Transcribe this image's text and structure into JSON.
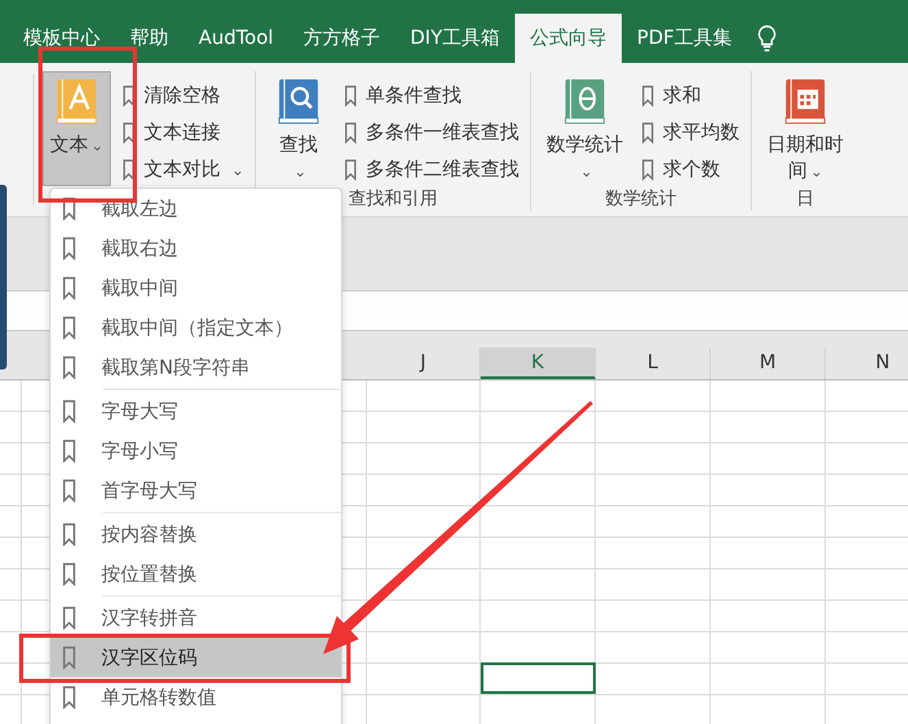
{
  "tabs": [
    {
      "label": "模板中心",
      "selected": false
    },
    {
      "label": "帮助",
      "selected": false
    },
    {
      "label": "AudTool",
      "selected": false
    },
    {
      "label": "方方格子",
      "selected": false
    },
    {
      "label": "DIY工具箱",
      "selected": false
    },
    {
      "label": "公式向导",
      "selected": true
    },
    {
      "label": "PDF工具集",
      "selected": false
    }
  ],
  "ribbon": {
    "groups": [
      {
        "large": {
          "label": "文本",
          "kind": "text",
          "selected": true,
          "caret": "⌄"
        },
        "small": [
          {
            "label": "清除空格"
          },
          {
            "label": "文本连接"
          },
          {
            "label": "文本对比",
            "caret": "⌄"
          }
        ]
      },
      {
        "label": "查找和引用",
        "large": {
          "label": "查找",
          "kind": "search",
          "selected": false,
          "caret": "⌄"
        },
        "small": [
          {
            "label": "单条件查找"
          },
          {
            "label": "多条件一维表查找"
          },
          {
            "label": "多条件二维表查找"
          }
        ]
      },
      {
        "label": "数学统计",
        "large": {
          "label": "数学统计",
          "kind": "stats",
          "selected": false,
          "caret": "⌄"
        },
        "small": [
          {
            "label": "求和"
          },
          {
            "label": "求平均数"
          },
          {
            "label": "求个数"
          }
        ]
      },
      {
        "label": "日",
        "large": {
          "label": "日期和时间",
          "kind": "calendar",
          "selected": false,
          "caret": "⌄"
        }
      }
    ]
  },
  "menu": {
    "sections": [
      [
        {
          "label": "截取左边",
          "selected": false
        },
        {
          "label": "截取右边",
          "selected": false
        },
        {
          "label": "截取中间",
          "selected": false
        },
        {
          "label": "截取中间（指定文本）",
          "selected": false
        },
        {
          "label": "截取第N段字符串",
          "selected": false
        }
      ],
      [
        {
          "label": "字母大写",
          "selected": false
        },
        {
          "label": "字母小写",
          "selected": false
        },
        {
          "label": "首字母大写",
          "selected": false
        }
      ],
      [
        {
          "label": "按内容替换",
          "selected": false
        },
        {
          "label": "按位置替换",
          "selected": false
        }
      ],
      [
        {
          "label": "汉字转拼音",
          "selected": false
        },
        {
          "label": "汉字区位码",
          "selected": true
        },
        {
          "label": "单元格转数值",
          "selected": false
        }
      ]
    ]
  },
  "sheet": {
    "columns": [
      {
        "label": "J",
        "selected": false
      },
      {
        "label": "K",
        "selected": true
      },
      {
        "label": "L",
        "selected": false
      },
      {
        "label": "M",
        "selected": false
      },
      {
        "label": "N",
        "selected": false
      }
    ],
    "rows": [
      {
        "selected": false
      },
      {
        "selected": false
      },
      {
        "selected": false
      },
      {
        "selected": false
      },
      {
        "selected": false
      },
      {
        "selected": false
      },
      {
        "selected": false
      },
      {
        "selected": false
      },
      {
        "selected": false
      },
      {
        "selected": true
      },
      {
        "selected": false
      }
    ]
  }
}
